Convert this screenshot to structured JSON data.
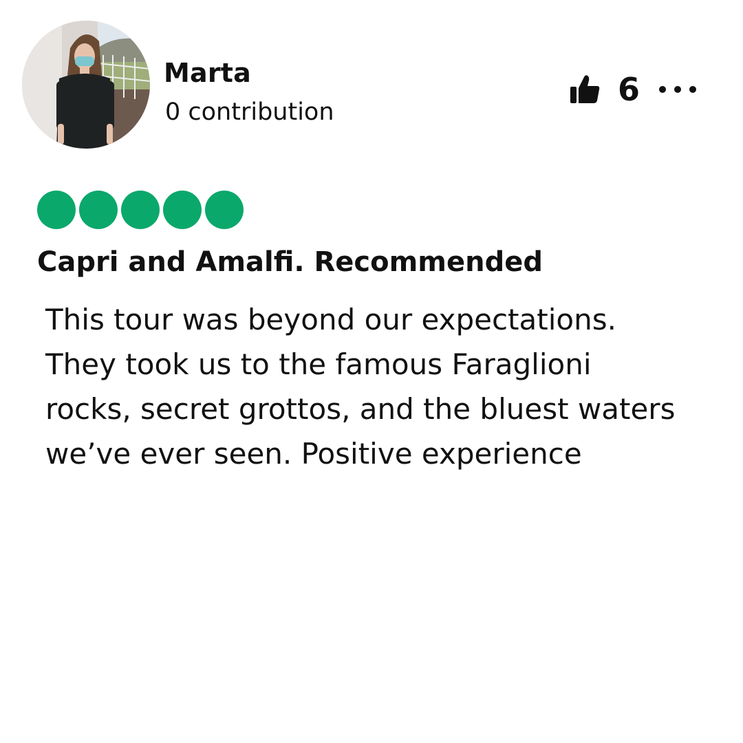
{
  "reviewer": {
    "name": "Marta",
    "contributions": "0 contribution",
    "avatar": "reviewer-photo"
  },
  "actions": {
    "helpful_icon": "thumbs-up-icon",
    "helpful_count": "6",
    "more_icon": "more-options-icon"
  },
  "rating": {
    "value": 5,
    "max": 5,
    "color": "#0aa86b"
  },
  "review": {
    "title": "Capri and Amalfi. Recommended",
    "body_lines": [
      "This tour was beyond our expectations.",
      "They took us to the famous Faraglioni",
      "rocks, secret grottos, and the bluest waters",
      "we’ve ever seen. Positive experience"
    ]
  }
}
